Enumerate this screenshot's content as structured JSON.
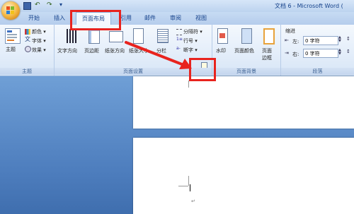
{
  "window": {
    "title": "文档 6 - Microsoft Word ("
  },
  "tabs": [
    {
      "label": "开始"
    },
    {
      "label": "插入"
    },
    {
      "label": "页面布局"
    },
    {
      "label": "引用"
    },
    {
      "label": "邮件"
    },
    {
      "label": "审阅"
    },
    {
      "label": "视图"
    }
  ],
  "ribbon": {
    "theme_group": {
      "label": "主题",
      "themes_button": "主题",
      "colors": "颜色 ▾",
      "fonts": "字体 ▾",
      "effects": "效果 ▾"
    },
    "page_setup_group": {
      "label": "页面设置",
      "text_direction": "文字方向",
      "margins": "页边距",
      "orientation": "纸张方向",
      "size": "纸张大小",
      "columns": "分栏",
      "breaks": "分隔符 ▾",
      "line_numbers": "行号 ▾",
      "hyphenation": "断字 ▾"
    },
    "page_background_group": {
      "label": "页面背景",
      "watermark": "水印",
      "page_color": "页面颜色",
      "page_borders_l1": "页面",
      "page_borders_l2": "边框"
    },
    "paragraph_group": {
      "label": "段落",
      "indent_title": "缩进",
      "left_label": "左:",
      "left_value": "0 字符",
      "right_label": "右:",
      "right_value": "0 字符"
    }
  },
  "document": {
    "paragraph_mark": "↵"
  },
  "colors": {
    "highlight": "#e8231e"
  }
}
